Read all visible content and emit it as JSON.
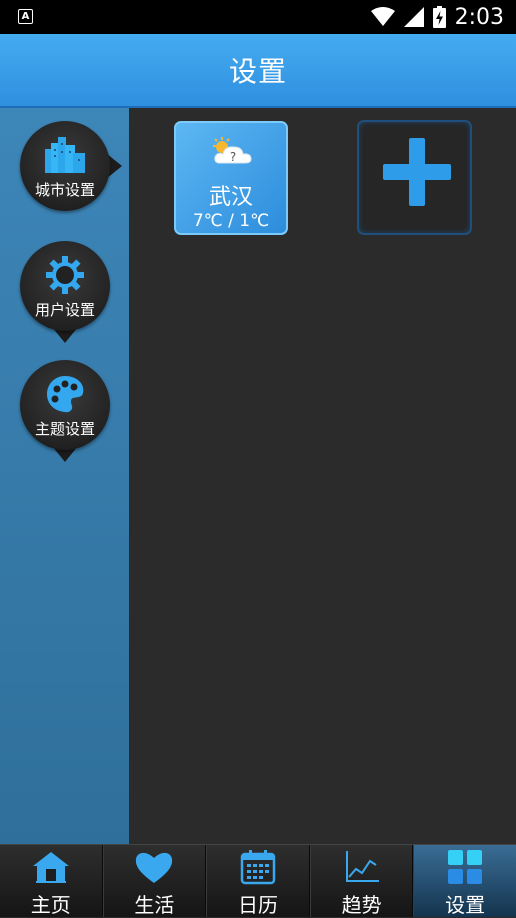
{
  "status_bar": {
    "notification_icon": "A",
    "time": "2:03",
    "icons": [
      "wifi-icon",
      "cell-signal-icon",
      "battery-charging-icon"
    ]
  },
  "header": {
    "title": "设置"
  },
  "sidebar": {
    "items": [
      {
        "label": "城市设置",
        "icon": "city-buildings-icon"
      },
      {
        "label": "用户设置",
        "icon": "gear-icon"
      },
      {
        "label": "主题设置",
        "icon": "palette-icon"
      }
    ]
  },
  "cities": [
    {
      "name": "武汉",
      "temp": "7℃ / 1℃",
      "weather_icon": "partly-cloudy-unknown-icon"
    }
  ],
  "add_city": {
    "icon": "plus-icon"
  },
  "bottom_nav": {
    "tabs": [
      {
        "label": "主页",
        "icon": "home-icon"
      },
      {
        "label": "生活",
        "icon": "heart-icon"
      },
      {
        "label": "日历",
        "icon": "calendar-icon"
      },
      {
        "label": "趋势",
        "icon": "trend-chart-icon"
      },
      {
        "label": "设置",
        "icon": "grid-icon",
        "active": true
      }
    ]
  },
  "colors": {
    "header": "#3a9eea",
    "sidebar": "#3a7fb0",
    "accent": "#3aa6ec",
    "background": "#2b2b2b"
  }
}
